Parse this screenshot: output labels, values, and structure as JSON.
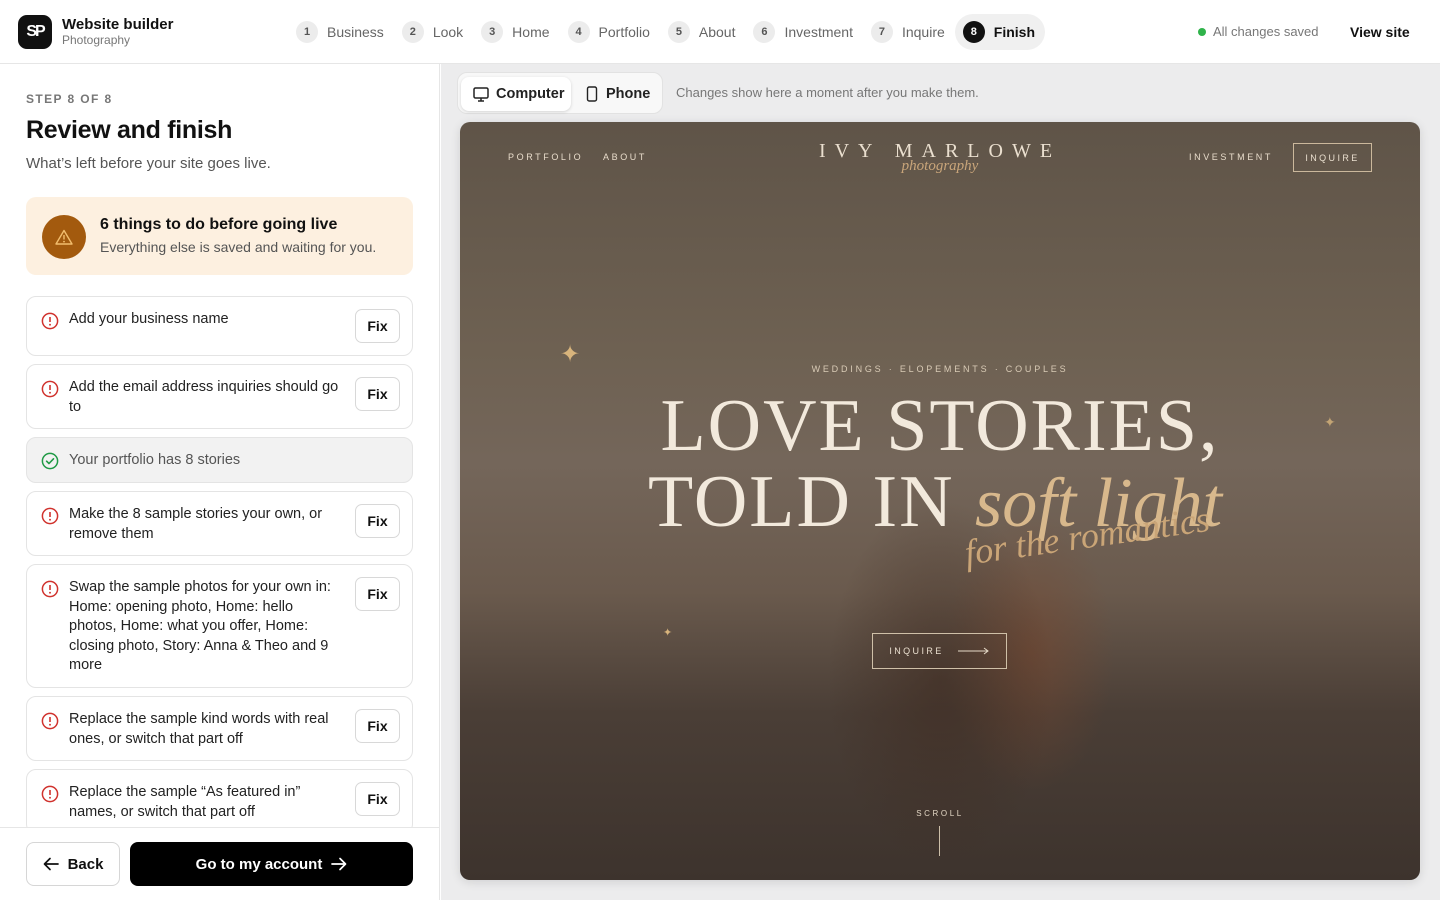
{
  "brand": {
    "title": "Website builder",
    "subtitle": "Photography",
    "logo_text": "SP"
  },
  "steps": [
    {
      "num": "1",
      "label": "Business"
    },
    {
      "num": "2",
      "label": "Look"
    },
    {
      "num": "3",
      "label": "Home"
    },
    {
      "num": "4",
      "label": "Portfolio"
    },
    {
      "num": "5",
      "label": "About"
    },
    {
      "num": "6",
      "label": "Investment"
    },
    {
      "num": "7",
      "label": "Inquire"
    },
    {
      "num": "8",
      "label": "Finish"
    }
  ],
  "active_step": 8,
  "header": {
    "saved_text": "All changes saved",
    "view_site": "View site",
    "saved_color": "#2fb34a"
  },
  "panel": {
    "step_of": "STEP 8 OF 8",
    "title": "Review and finish",
    "subtitle": "What’s left before your site goes live.",
    "alert": {
      "title": "6 things to do before going live",
      "text": "Everything else is saved and waiting for you.",
      "icon": "warning-icon"
    },
    "fix_label": "Fix",
    "items": [
      {
        "text": "Add your business name",
        "status": "todo"
      },
      {
        "text": "Add the email address inquiries should go to",
        "status": "todo"
      },
      {
        "text": "Your portfolio has 8 stories",
        "status": "done"
      },
      {
        "text": "Make the 8 sample stories your own, or remove them",
        "status": "todo"
      },
      {
        "text": "Swap the sample photos for your own in: Home: opening photo, Home: hello photos, Home: what you offer, Home: closing photo, Story: Anna & Theo and 9 more",
        "status": "todo"
      },
      {
        "text": "Replace the sample kind words with real ones, or switch that part off",
        "status": "todo"
      },
      {
        "text": "Replace the sample “As featured in” names, or switch that part off",
        "status": "todo"
      }
    ],
    "back": "Back",
    "go": "Go to my account"
  },
  "preview_bar": {
    "computer": "Computer",
    "phone": "Phone",
    "hint": "Changes show here a moment after you make them."
  },
  "site": {
    "nav_left": [
      "PORTFOLIO",
      "ABOUT"
    ],
    "logo": "IVY MARLOWE",
    "logo_script": "photography",
    "nav_right": "INVESTMENT",
    "nav_cta": "INQUIRE",
    "tags": "WEDDINGS · ELOPEMENTS · COUPLES",
    "headline_1": "LOVE STORIES,",
    "headline_2a": "TOLD IN ",
    "headline_2b": "soft light",
    "script_line": "for the romantics",
    "cta": "INQUIRE",
    "scroll": "SCROLL"
  }
}
